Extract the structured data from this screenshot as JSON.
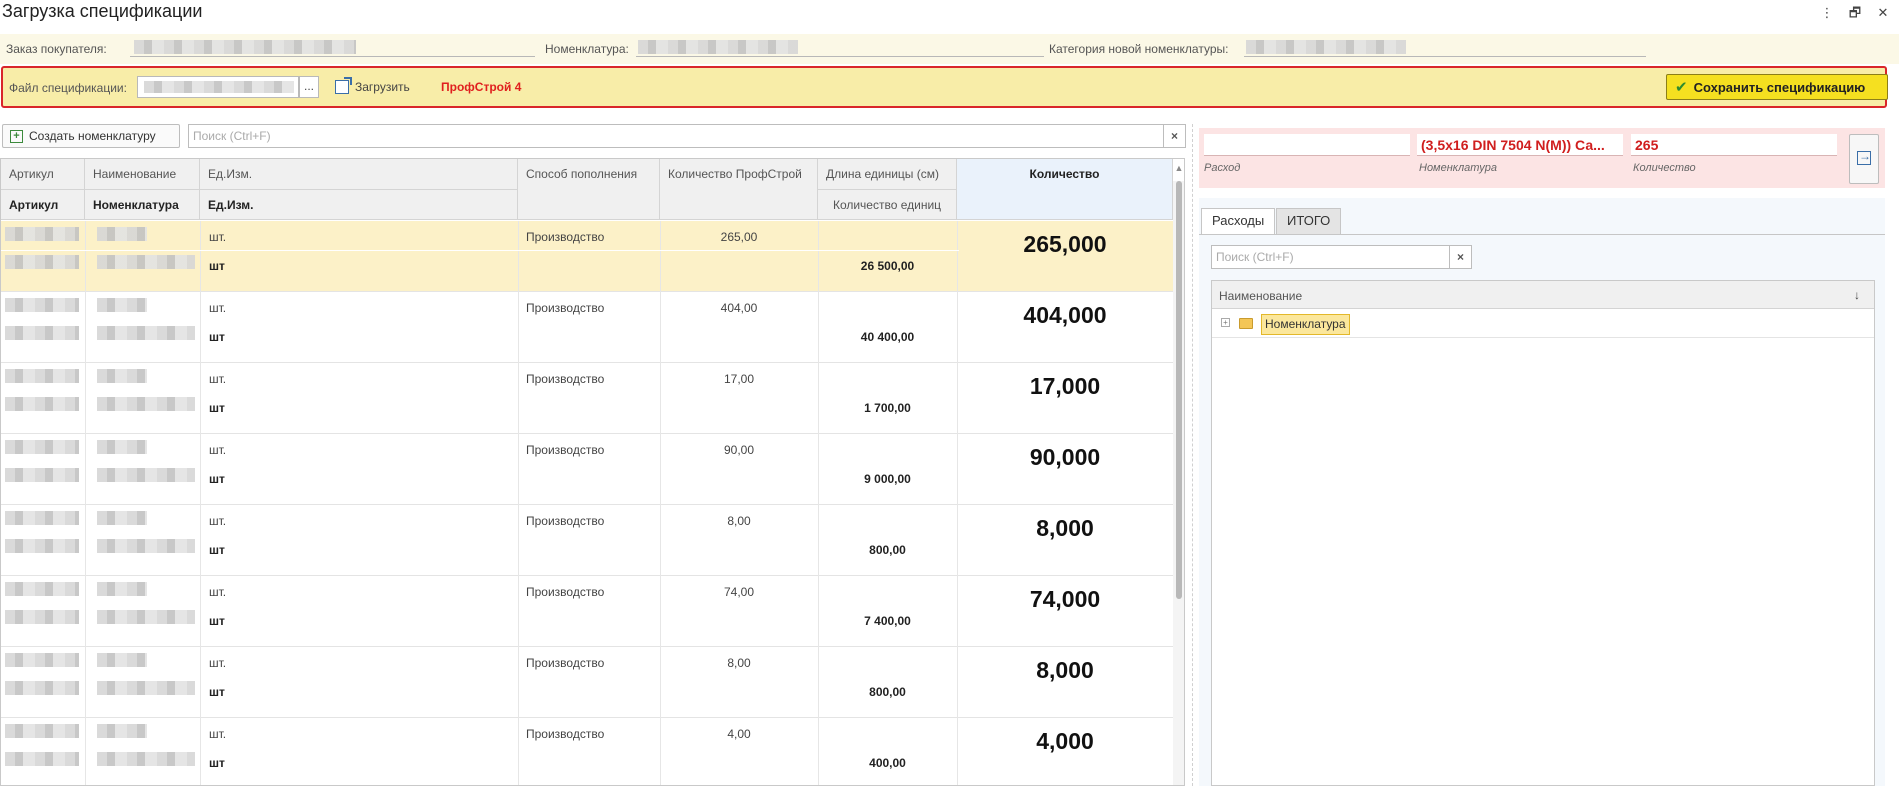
{
  "window": {
    "title": "Загрузка спецификации",
    "more_icon": "⋮",
    "restore_icon": "🗗",
    "close_icon": "✕"
  },
  "header": {
    "order_label": "Заказ покупателя:",
    "nomenclature_label": "Номенклатура:",
    "category_label": "Категория новой номенклатуры:"
  },
  "spec": {
    "file_label": "Файл спецификации:",
    "browse_label": "...",
    "load_label": "Загрузить",
    "brand_label": "ПрофСтрой 4",
    "save_label": "Сохранить спецификацию",
    "save_icon": "✔"
  },
  "left_toolbar": {
    "create_label": "Создать номенклатуру",
    "create_icon": "+",
    "search_placeholder": "Поиск (Ctrl+F)",
    "clear_icon": "×"
  },
  "table": {
    "headers": {
      "article": "Артикул",
      "name": "Наименование",
      "unit": "Ед.Изм.",
      "article2": "Артикул",
      "nomenclature": "Номенклатура",
      "unit2": "Ед.Изм.",
      "method": "Способ пополнения",
      "qty_profstroy": "Количество ПрофСтрой",
      "unit_length": "Длина единицы (см)",
      "unit_count": "Количество единиц",
      "quantity": "Количество"
    },
    "rows": [
      {
        "unit": "шт.",
        "unit2": "шт",
        "method": "Производство",
        "qty_ps": "265,00",
        "units": "26 500,00",
        "qty": "265,000"
      },
      {
        "unit": "шт.",
        "unit2": "шт",
        "method": "Производство",
        "qty_ps": "404,00",
        "units": "40 400,00",
        "qty": "404,000"
      },
      {
        "unit": "шт.",
        "unit2": "шт",
        "method": "Производство",
        "qty_ps": "17,00",
        "units": "1 700,00",
        "qty": "17,000"
      },
      {
        "unit": "шт.",
        "unit2": "шт",
        "method": "Производство",
        "qty_ps": "90,00",
        "units": "9 000,00",
        "qty": "90,000"
      },
      {
        "unit": "шт.",
        "unit2": "шт",
        "method": "Производство",
        "qty_ps": "8,00",
        "units": "800,00",
        "qty": "8,000"
      },
      {
        "unit": "шт.",
        "unit2": "шт",
        "method": "Производство",
        "qty_ps": "74,00",
        "units": "7 400,00",
        "qty": "74,000"
      },
      {
        "unit": "шт.",
        "unit2": "шт",
        "method": "Производство",
        "qty_ps": "8,00",
        "units": "800,00",
        "qty": "8,000"
      },
      {
        "unit": "шт.",
        "unit2": "шт",
        "method": "Производство",
        "qty_ps": "4,00",
        "units": "400,00",
        "qty": "4,000"
      }
    ]
  },
  "info": {
    "expense_value": "",
    "nomenclature_value": "(3,5x16 DIN 7504 N(M)) Са...",
    "quantity_value": "265",
    "expense_caption": "Расход",
    "nomenclature_caption": "Номенклатура",
    "quantity_caption": "Количество"
  },
  "tabs": {
    "expenses": "Расходы",
    "total": "ИТОГО"
  },
  "right_search": {
    "placeholder": "Поиск (Ctrl+F)",
    "clear_icon": "×"
  },
  "tree": {
    "header": "Наименование",
    "sort_icon": "↓",
    "expand_icon": "+",
    "root_label": "Номенклатура"
  },
  "colors": {
    "highlight_border": "#d9262a",
    "brand_text": "#e0201f",
    "save_button": "#f5e020",
    "selected_row": "#fcf1c8"
  }
}
